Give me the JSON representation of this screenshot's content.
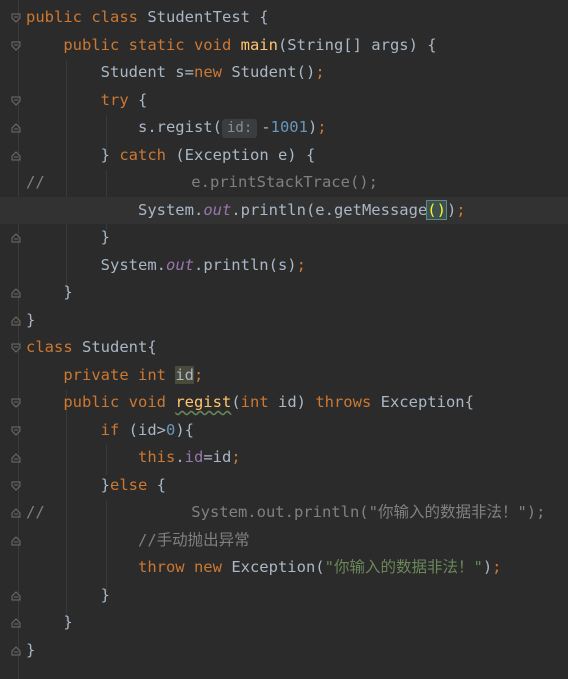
{
  "editor": {
    "lines": [
      {
        "tokens": [
          [
            "kw",
            "public class "
          ],
          [
            "",
            "StudentTest {"
          ]
        ]
      },
      {
        "tokens": [
          [
            "",
            "    "
          ],
          [
            "kw",
            "public static void "
          ],
          [
            "fn",
            "main"
          ],
          [
            "",
            "(String[] args) {"
          ]
        ]
      },
      {
        "tokens": [
          [
            "",
            "        Student s="
          ],
          [
            "kw",
            "new "
          ],
          [
            "",
            "Student()"
          ],
          [
            "kw",
            ";"
          ]
        ]
      },
      {
        "tokens": [
          [
            "",
            "        "
          ],
          [
            "kw",
            "try "
          ],
          [
            "",
            "{"
          ]
        ]
      },
      {
        "tokens": [
          [
            "",
            "            s.regist("
          ],
          [
            "hint",
            "id:"
          ],
          [
            "",
            "-"
          ],
          [
            "num",
            "1001"
          ],
          [
            "",
            ")"
          ],
          [
            "kw",
            ";"
          ]
        ]
      },
      {
        "tokens": [
          [
            "",
            "        } "
          ],
          [
            "kw",
            "catch "
          ],
          [
            "",
            "(Exception e) {"
          ]
        ]
      },
      {
        "comment": "//",
        "tokens": [
          [
            "cmt",
            "                e.printStackTrace();"
          ]
        ]
      },
      {
        "current": true,
        "tokens": [
          [
            "",
            "            System."
          ],
          [
            "static-fld",
            "out"
          ],
          [
            "",
            ".println(e.getMessage"
          ],
          [
            "brace-match",
            "()"
          ],
          [
            "caret",
            ""
          ],
          [
            "",
            ")"
          ],
          [
            "kw",
            ";"
          ]
        ]
      },
      {
        "tokens": [
          [
            "",
            "        }"
          ]
        ]
      },
      {
        "tokens": [
          [
            "",
            "        System."
          ],
          [
            "static-fld",
            "out"
          ],
          [
            "",
            ".println(s)"
          ],
          [
            "kw",
            ";"
          ]
        ]
      },
      {
        "tokens": [
          [
            "",
            "    }"
          ]
        ]
      },
      {
        "tokens": [
          [
            "",
            "}"
          ]
        ]
      },
      {
        "tokens": [
          [
            "kw",
            "class "
          ],
          [
            "",
            "Student{"
          ]
        ]
      },
      {
        "tokens": [
          [
            "",
            "    "
          ],
          [
            "kw",
            "private int "
          ],
          [
            "hl-field",
            "id"
          ],
          [
            "kw",
            ";"
          ]
        ]
      },
      {
        "tokens": [
          [
            "",
            "    "
          ],
          [
            "kw",
            "public void "
          ],
          [
            "fn wavy",
            "regist"
          ],
          [
            "",
            "("
          ],
          [
            "kw",
            "int "
          ],
          [
            "",
            "id) "
          ],
          [
            "kw",
            "throws "
          ],
          [
            "",
            "Exception{"
          ]
        ]
      },
      {
        "tokens": [
          [
            "",
            "        "
          ],
          [
            "kw",
            "if "
          ],
          [
            "",
            "(id>"
          ],
          [
            "num",
            "0"
          ],
          [
            "",
            "){"
          ]
        ]
      },
      {
        "tokens": [
          [
            "",
            "            "
          ],
          [
            "kw",
            "this"
          ],
          [
            "",
            "."
          ],
          [
            "fld",
            "id"
          ],
          [
            "",
            "=id"
          ],
          [
            "kw",
            ";"
          ]
        ]
      },
      {
        "tokens": [
          [
            "",
            "        }"
          ],
          [
            "kw",
            "else "
          ],
          [
            "",
            "{"
          ]
        ]
      },
      {
        "comment": "//",
        "tokens": [
          [
            "cmt",
            "                System.out.println(\"你输入的数据非法！\");"
          ]
        ]
      },
      {
        "tokens": [
          [
            "",
            "            "
          ],
          [
            "cmt",
            "//手动抛出异常"
          ]
        ]
      },
      {
        "tokens": [
          [
            "",
            "            "
          ],
          [
            "kw",
            "throw new "
          ],
          [
            "",
            "Exception("
          ],
          [
            "str",
            "\"你输入的数据非法！\""
          ],
          [
            "",
            ")"
          ],
          [
            "kw",
            ";"
          ]
        ]
      },
      {
        "tokens": [
          [
            "",
            "        }"
          ]
        ]
      },
      {
        "tokens": [
          [
            "",
            "    }"
          ]
        ]
      },
      {
        "tokens": [
          [
            "",
            "}"
          ]
        ]
      }
    ]
  }
}
